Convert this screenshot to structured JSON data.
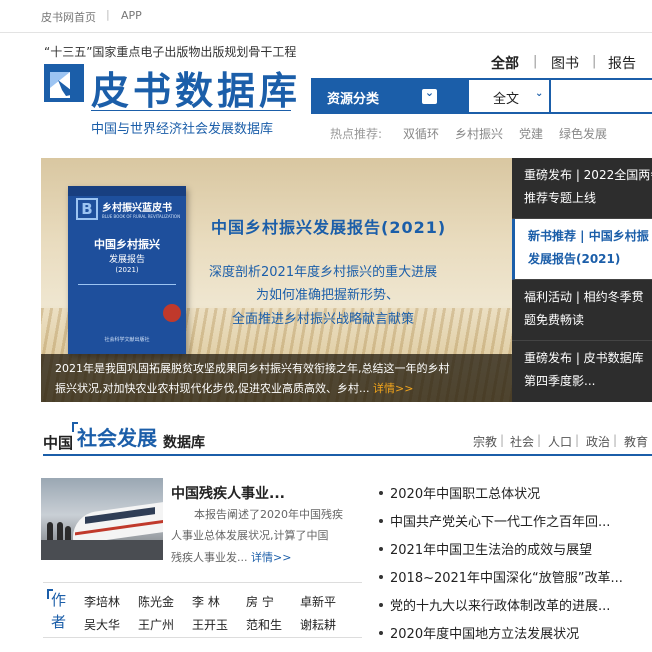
{
  "topbar": {
    "home": "皮书网首页",
    "sep": "|",
    "app": "APP"
  },
  "header": {
    "subtitle": "“十三五”国家重点电子出版物出版规划骨干工程",
    "logo_title": "皮书数据库",
    "logo_sub": "中国与世界经济社会发展数据库",
    "tabs": [
      {
        "label": "全部"
      },
      {
        "label": "图书"
      },
      {
        "label": "报告"
      }
    ],
    "tab_sep": "|"
  },
  "search": {
    "resource_label": "资源分类",
    "resource_icon": "chevron-down-icon",
    "resource_glyph": "⌄",
    "scope_value": "全文",
    "scope_glyph": "⌄",
    "placeholder": ""
  },
  "hot": {
    "label": "热点推荐:",
    "keywords": [
      "双循环",
      "乡村振兴",
      "党建",
      "绿色发展"
    ]
  },
  "banner": {
    "book": {
      "series": "乡村振兴蓝皮书",
      "series_en": "BLUE BOOK OF RURAL REVITALIZATION",
      "logo_letter": "B",
      "title": "中国乡村振兴",
      "subtitle": "发展报告",
      "year": "(2021)",
      "publisher": "社会科学文献出版社"
    },
    "title": "中国乡村振兴发展报告(2021)",
    "line1": "深度剖析2021年度乡村振兴的重大进展",
    "line2": "为如何准确把握新形势、",
    "line3": "全面推进乡村振兴战略献言献策",
    "caption_line1": "2021年是我国巩固拓展脱贫攻坚成果同乡村振兴有效衔接之年,总结这一年的乡村",
    "caption_line2": "振兴状况,对加快农业农村现代化步伐,促进农业高质高效、乡村",
    "caption_ellipsis": "...",
    "caption_more": "详情>>"
  },
  "news": [
    {
      "line1": "重磅发布 | 2022全国两会",
      "line2": "推荐专题上线"
    },
    {
      "line1": "新书推荐 | 中国乡村振",
      "line2": "发展报告(2021)"
    },
    {
      "line1": "福利活动 | 相约冬季贯",
      "line2": "题免费畅读"
    },
    {
      "line1": "重磅发布 | 皮书数据库",
      "line2": "第四季度影..."
    }
  ],
  "section": {
    "part1": "中国",
    "part2": "社会发展",
    "part3": "数据库",
    "tabs": [
      "宗教",
      "社会",
      "人口",
      "政治",
      "教育"
    ],
    "tab_sep": "|"
  },
  "feature": {
    "title": "中国残疾人事业...",
    "line1": "本报告阐述了2020年中国残疾",
    "line2": "人事业总体发展状况,计算了中国",
    "line3": "残疾人事业发...",
    "more": "详情>>"
  },
  "authors": {
    "label_top": "作",
    "label_bottom": "者",
    "row1": [
      "李培林",
      "陈光金",
      "李 林",
      "房 宁",
      "卓新平"
    ],
    "row2": [
      "吴大华",
      "王广州",
      "王开玉",
      "范和生",
      "谢耘耕"
    ]
  },
  "reports": [
    "2020年中国职工总体状况",
    "中国共产党关心下一代工作之百年回...",
    "2021年中国卫生法治的成效与展望",
    "2018~2021年中国深化“放管服”改革...",
    "党的十九大以来行政体制改革的进展...",
    "2020年度中国地方立法发展状况"
  ],
  "colors": {
    "brand_blue": "#1b5ea9",
    "news_bg": "#2d2d2d",
    "link_orange": "#f2a51c"
  }
}
